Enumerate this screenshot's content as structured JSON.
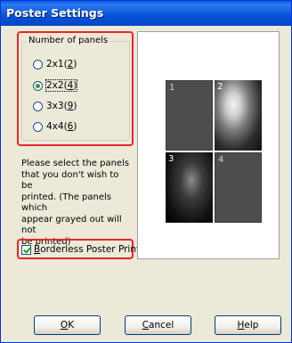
{
  "window": {
    "title": "Poster Settings"
  },
  "panels_group": {
    "label": "Number of panels",
    "options": [
      {
        "label": "2x1(",
        "accel": "2",
        "suffix": ")",
        "checked": false
      },
      {
        "label": "2x2(",
        "accel": "4",
        "suffix": ")",
        "checked": true
      },
      {
        "label": "3x3(",
        "accel": "9",
        "suffix": ")",
        "checked": false
      },
      {
        "label": "4x4(",
        "accel": "6",
        "suffix": ")",
        "checked": false
      }
    ]
  },
  "instructions": "Please select the panels\nthat you don't wish to be\nprinted. (The panels which\nappear grayed out will not\nbe printed)",
  "borderless": {
    "accel": "B",
    "label_rest": "orderless Poster Print",
    "checked": true
  },
  "preview": {
    "panels": [
      {
        "number": "1",
        "state": "grayed-out"
      },
      {
        "number": "2",
        "state": "printed"
      },
      {
        "number": "3",
        "state": "printed"
      },
      {
        "number": "4",
        "state": "grayed-out"
      }
    ]
  },
  "buttons": {
    "ok": {
      "accel": "O",
      "rest": "K"
    },
    "cancel": {
      "accel": "C",
      "rest": "ancel"
    },
    "help": {
      "accel": "H",
      "rest": "elp"
    }
  },
  "colors": {
    "highlight": "#e8262b",
    "titlebar": "#0a5ee8"
  }
}
